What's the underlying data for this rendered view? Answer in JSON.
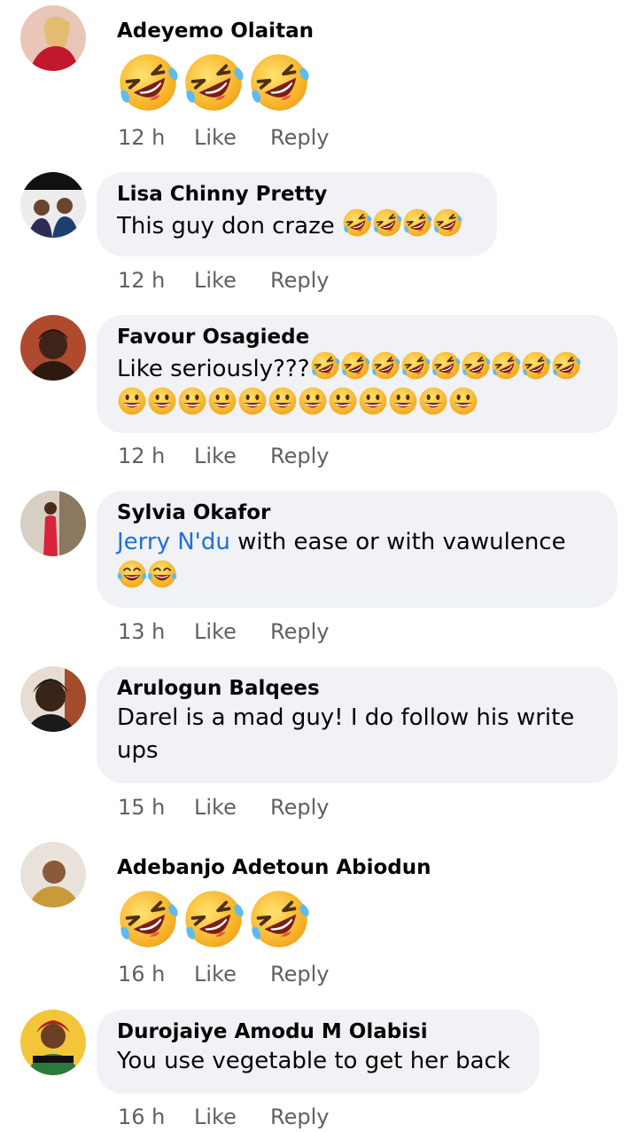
{
  "comments": [
    {
      "author": "Adeyemo Olaitan",
      "time": "12 h",
      "like": "Like",
      "reply": "Reply"
    },
    {
      "author": "Lisa Chinny Pretty",
      "text": "This guy don craze ",
      "time": "12 h",
      "like": "Like",
      "reply": "Reply"
    },
    {
      "author": "Favour Osagiede",
      "text": "Like seriously???",
      "time": "12 h",
      "like": "Like",
      "reply": "Reply"
    },
    {
      "author": "Sylvia Okafor",
      "mention": "Jerry N'du",
      "text": " with ease or with vawulence",
      "time": "13 h",
      "like": "Like",
      "reply": "Reply"
    },
    {
      "author": "Arulogun Balqees",
      "text": "Darel is a mad guy! I do follow his write ups",
      "time": "15 h",
      "like": "Like",
      "reply": "Reply"
    },
    {
      "author": "Adebanjo Adetoun Abiodun",
      "time": "16 h",
      "like": "Like",
      "reply": "Reply"
    },
    {
      "author": "Durojaiye Amodu M Olabisi",
      "text": "You use vegetable to get her back",
      "time": "16 h",
      "like": "Like",
      "reply": "Reply"
    }
  ],
  "icons": {
    "rofl": "rolling-on-floor-laughing-emoji",
    "grin": "grinning-face-emoji",
    "joy": "tears-of-joy-emoji"
  },
  "colors": {
    "bubble": "#f0f2f5",
    "mention": "#216fdb",
    "meta": "#5f6166",
    "emoji_yellow": "#fbc02d"
  }
}
